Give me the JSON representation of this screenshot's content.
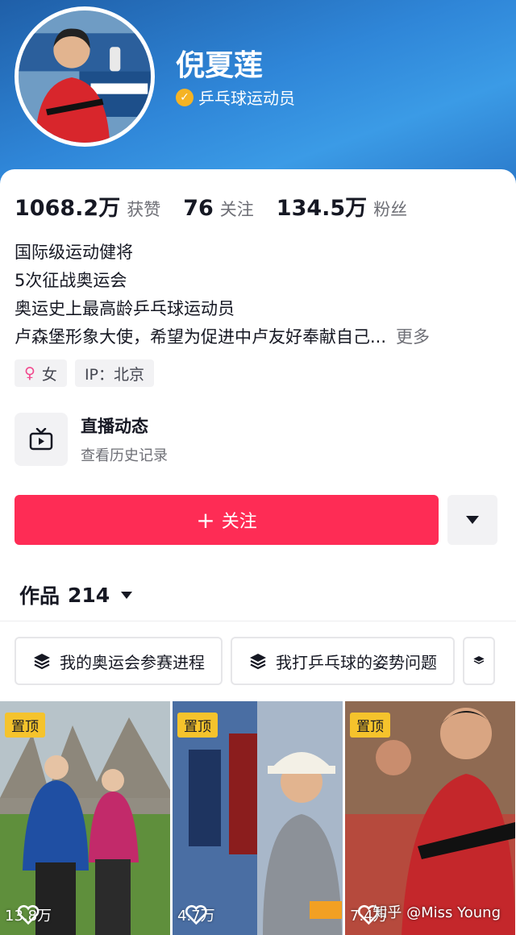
{
  "profile": {
    "name": "倪夏莲",
    "verified_label": "乒乓球运动员",
    "avatar_icon": "avatar-photo"
  },
  "stats": [
    {
      "value": "1068.2万",
      "label": "获赞"
    },
    {
      "value": "76",
      "label": "关注"
    },
    {
      "value": "134.5万",
      "label": "粉丝"
    }
  ],
  "bio": {
    "lines": [
      "国际级运动健将",
      "5次征战奥运会",
      "奥运史上最高龄乒乓球运动员",
      "卢森堡形象大使，希望为促进中卢友好奉献自己..."
    ],
    "more_label": "更多"
  },
  "tags": {
    "gender": "女",
    "ip": "IP：北京"
  },
  "live": {
    "title": "直播动态",
    "subtitle": "查看历史记录"
  },
  "follow_button": {
    "label": "关注",
    "color": "#fe2c55"
  },
  "works": {
    "label": "作品",
    "count": "214"
  },
  "collections": [
    {
      "label": "我的奥运会参赛进程"
    },
    {
      "label": "我打乒乓球的姿势问题"
    }
  ],
  "videos": [
    {
      "pinned_label": "置顶",
      "likes": "13.8万"
    },
    {
      "pinned_label": "置顶",
      "likes": "4.7万"
    },
    {
      "pinned_label": "置顶",
      "likes": "7.4万"
    }
  ],
  "watermark": "知乎 @Miss Young"
}
